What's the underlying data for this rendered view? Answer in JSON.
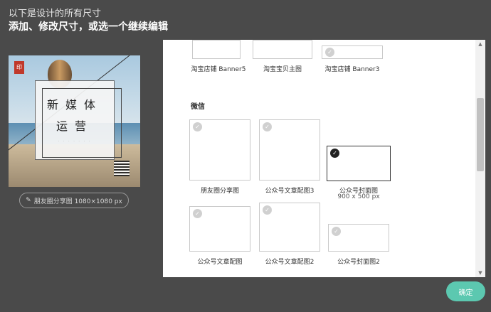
{
  "header": {
    "line1": "以下是设计的所有尺寸",
    "line2": "添加、修改尺寸，或选一个继续编辑"
  },
  "preview": {
    "title_line1": "新媒体",
    "title_line2": "运营",
    "size_label": "朋友圈分享图 1080×1080 px",
    "edit_icon": "pencil-icon"
  },
  "modal": {
    "top_row": [
      {
        "label": "淘宝店铺 Banner5"
      },
      {
        "label": "淘宝宝贝主图"
      },
      {
        "label": "淘宝店铺 Banner3"
      }
    ],
    "section_title": "微信",
    "wechat_items": [
      {
        "label": "朋友圈分享图",
        "selected": false
      },
      {
        "label": "公众号文章配图3",
        "selected": false
      },
      {
        "label": "公众号封面图",
        "sub": "900 x 500 px",
        "selected": true
      },
      {
        "label": "公众号文章配图",
        "selected": false
      },
      {
        "label": "公众号文章配图2",
        "selected": false
      },
      {
        "label": "公众号封面图2",
        "selected": false
      }
    ]
  },
  "confirm_button": "确定",
  "colors": {
    "accent": "#5cc8b0",
    "overlay": "#4a4a4a"
  }
}
